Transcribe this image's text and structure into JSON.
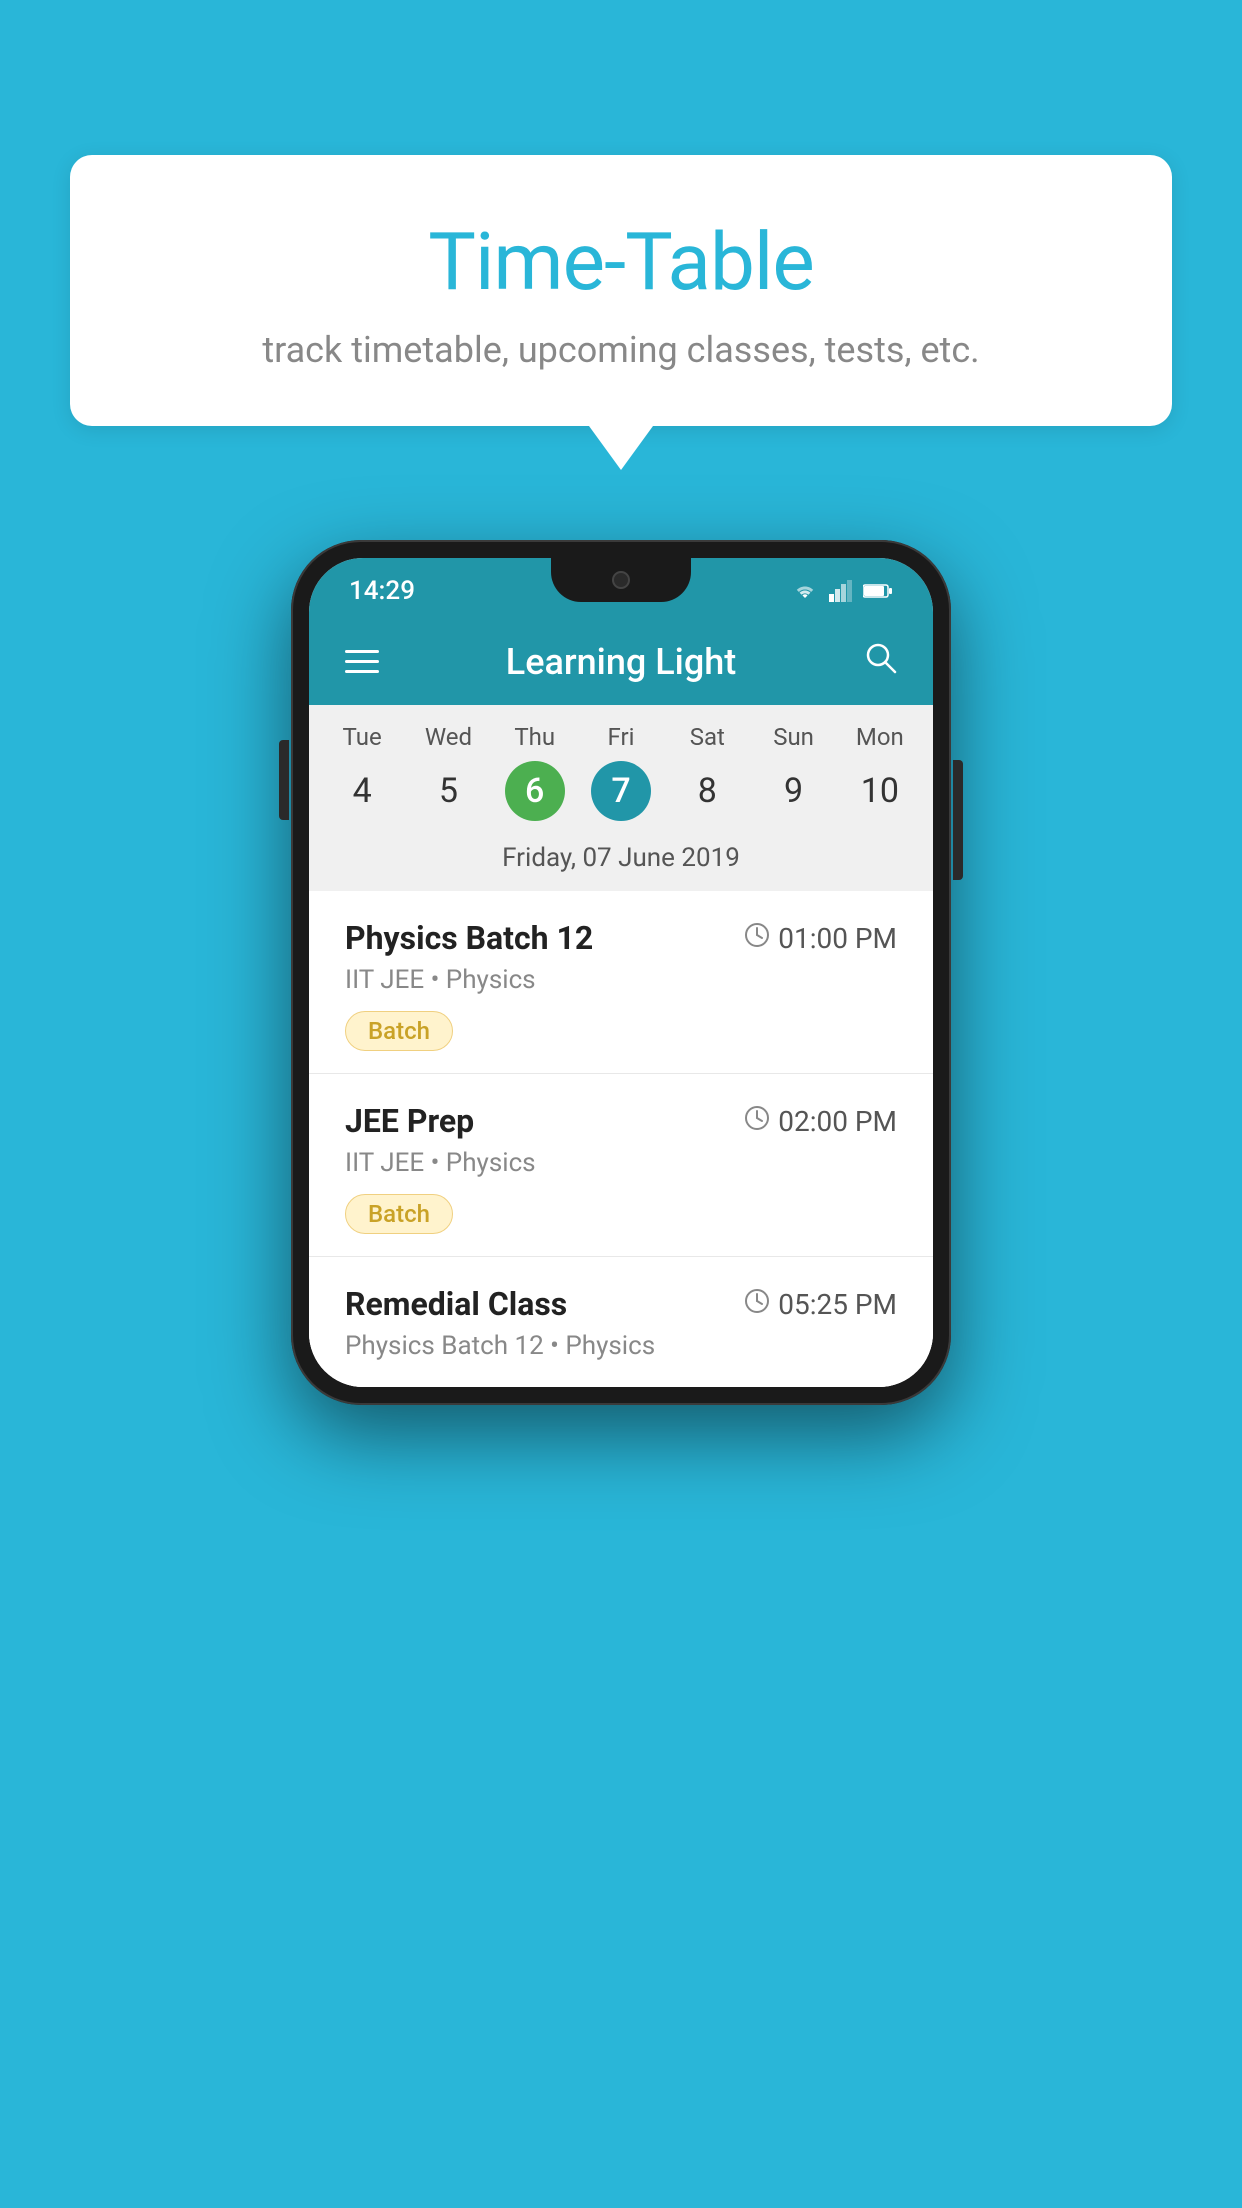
{
  "background_color": "#29B6D8",
  "speech_bubble": {
    "title": "Time-Table",
    "subtitle": "track timetable, upcoming classes, tests, etc."
  },
  "phone": {
    "status_bar": {
      "time": "14:29"
    },
    "app_bar": {
      "title": "Learning Light"
    },
    "calendar": {
      "days": [
        {
          "short": "Tue",
          "num": "4"
        },
        {
          "short": "Wed",
          "num": "5"
        },
        {
          "short": "Thu",
          "num": "6",
          "state": "today"
        },
        {
          "short": "Fri",
          "num": "7",
          "state": "selected"
        },
        {
          "short": "Sat",
          "num": "8"
        },
        {
          "short": "Sun",
          "num": "9"
        },
        {
          "short": "Mon",
          "num": "10"
        }
      ],
      "selected_date_label": "Friday, 07 June 2019"
    },
    "schedule": [
      {
        "title": "Physics Batch 12",
        "time": "01:00 PM",
        "subtitle": "IIT JEE • Physics",
        "badge": "Batch"
      },
      {
        "title": "JEE Prep",
        "time": "02:00 PM",
        "subtitle": "IIT JEE • Physics",
        "badge": "Batch"
      },
      {
        "title": "Remedial Class",
        "time": "05:25 PM",
        "subtitle": "Physics Batch 12 • Physics",
        "badge": null
      }
    ]
  },
  "icons": {
    "hamburger": "≡",
    "search": "🔍",
    "clock": "🕐"
  }
}
